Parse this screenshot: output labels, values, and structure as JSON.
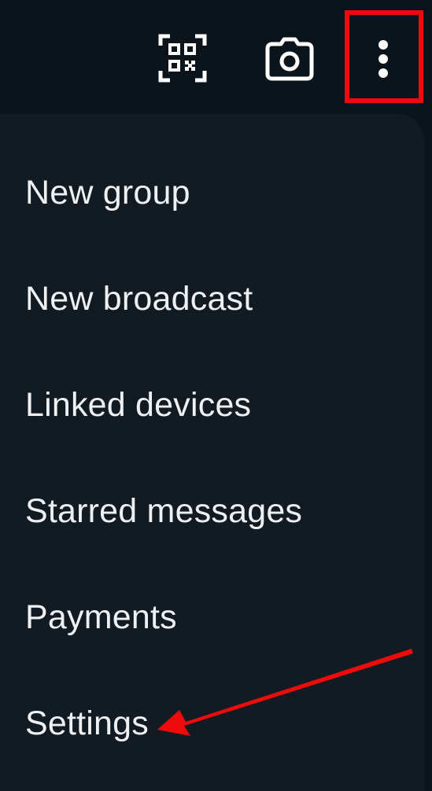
{
  "toolbar": {
    "icons": [
      {
        "name": "qr-scanner-icon"
      },
      {
        "name": "camera-icon"
      },
      {
        "name": "more-options-icon"
      }
    ]
  },
  "menu": {
    "items": [
      {
        "label": "New group"
      },
      {
        "label": "New broadcast"
      },
      {
        "label": "Linked devices"
      },
      {
        "label": "Starred messages"
      },
      {
        "label": "Payments"
      },
      {
        "label": "Settings"
      }
    ]
  },
  "colors": {
    "background": "#0b141a",
    "menu_background": "#121b21",
    "text": "#eef1f3",
    "highlight": "#ef0b0b"
  }
}
